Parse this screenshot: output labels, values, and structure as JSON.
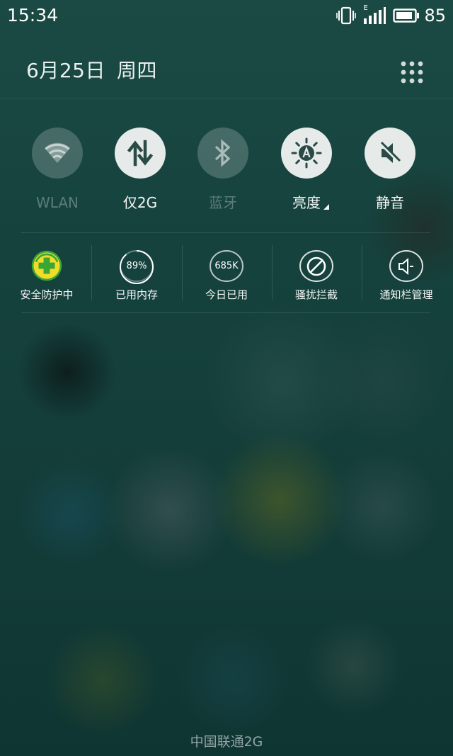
{
  "status_bar": {
    "time": "15:34",
    "network_type": "E",
    "battery_level": "85",
    "icons": [
      "vibrate-icon",
      "signal-icon",
      "battery-icon"
    ]
  },
  "header": {
    "date": "6月25日",
    "weekday": "周四",
    "grid_icon": "apps-grid-icon"
  },
  "toggles": [
    {
      "label": "WLAN",
      "icon": "wifi-icon",
      "state": "off"
    },
    {
      "label": "仅2G",
      "icon": "mobile-data-icon",
      "state": "on"
    },
    {
      "label": "蓝牙",
      "icon": "bluetooth-icon",
      "state": "off"
    },
    {
      "label": "亮度",
      "icon": "auto-brightness-icon",
      "state": "on"
    },
    {
      "label": "静音",
      "icon": "mute-icon",
      "state": "on"
    }
  ],
  "tools": [
    {
      "label": "安全防护中",
      "icon": "security-shield-icon"
    },
    {
      "label": "已用内存",
      "value": "89%",
      "icon": "memory-ring-icon"
    },
    {
      "label": "今日已用",
      "value": "685K",
      "icon": "data-usage-ring-icon"
    },
    {
      "label": "骚扰拦截",
      "icon": "block-icon"
    },
    {
      "label": "通知栏管理",
      "icon": "speaker-icon"
    }
  ],
  "carrier": "中国联通2G",
  "colors": {
    "toggle_on": "#e6ebea",
    "toggle_icon_dark": "#2a4a46",
    "shield_yellow": "#f2dc2a",
    "shield_green": "#3aa636"
  }
}
